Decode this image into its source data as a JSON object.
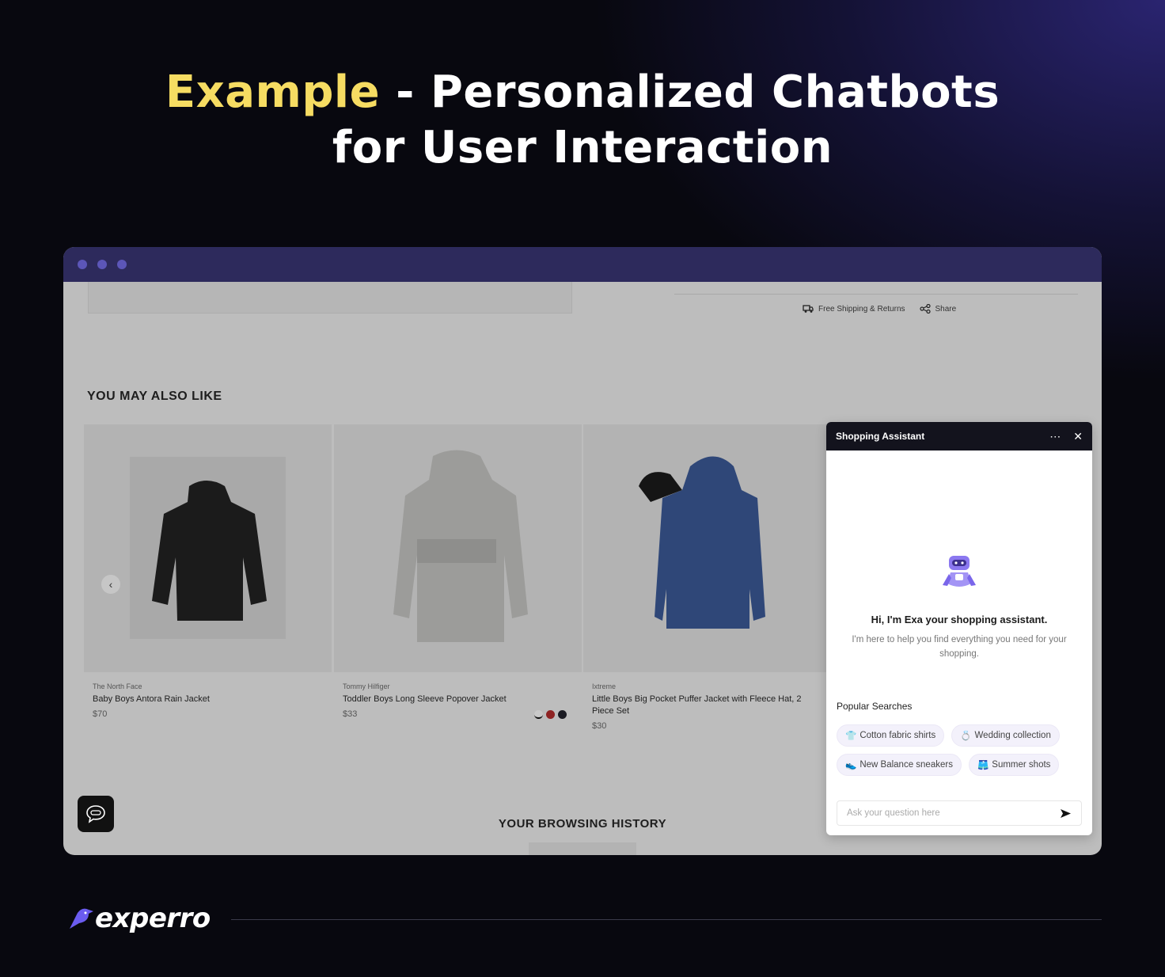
{
  "headline": {
    "highlight": "Example",
    "rest_line1": " - Personalized Chatbots",
    "line2": "for User Interaction"
  },
  "product_page": {
    "meta": {
      "shipping": "Free Shipping & Returns",
      "share": "Share"
    },
    "section_title": "YOU MAY ALSO LIKE",
    "products": [
      {
        "brand": "The North Face",
        "name": "Baby Boys Antora Rain Jacket",
        "price": "$70"
      },
      {
        "brand": "Tommy Hilfiger",
        "name": "Toddler Boys Long Sleeve Popover Jacket",
        "price": "$33",
        "swatches": [
          "#c9c9c9",
          "#8e2323",
          "#1a1a22"
        ]
      },
      {
        "brand": "Ixtreme",
        "name": "Little Boys Big Pocket Puffer Jacket with Fleece Hat, 2 Piece Set",
        "price": "$30"
      }
    ],
    "history_title": "YOUR BROWSING HISTORY"
  },
  "chat": {
    "title": "Shopping Assistant",
    "greeting": "Hi, I'm Exa your shopping assistant.",
    "subtitle": "I'm here to help you find everything you need for your shopping.",
    "popular_title": "Popular Searches",
    "chips": [
      {
        "emoji": "👕",
        "label": "Cotton fabric shirts"
      },
      {
        "emoji": "💍",
        "label": "Wedding collection"
      },
      {
        "emoji": "👟",
        "label": "New Balance sneakers"
      },
      {
        "emoji": "🩳",
        "label": "Summer shots"
      }
    ],
    "input_placeholder": "Ask your question here",
    "input_value": ""
  },
  "brand": {
    "logo": "experro"
  },
  "colors": {
    "accent": "#f6dc62",
    "titlebar": "#2d2a5c",
    "brand_purple": "#6b5cf0"
  }
}
